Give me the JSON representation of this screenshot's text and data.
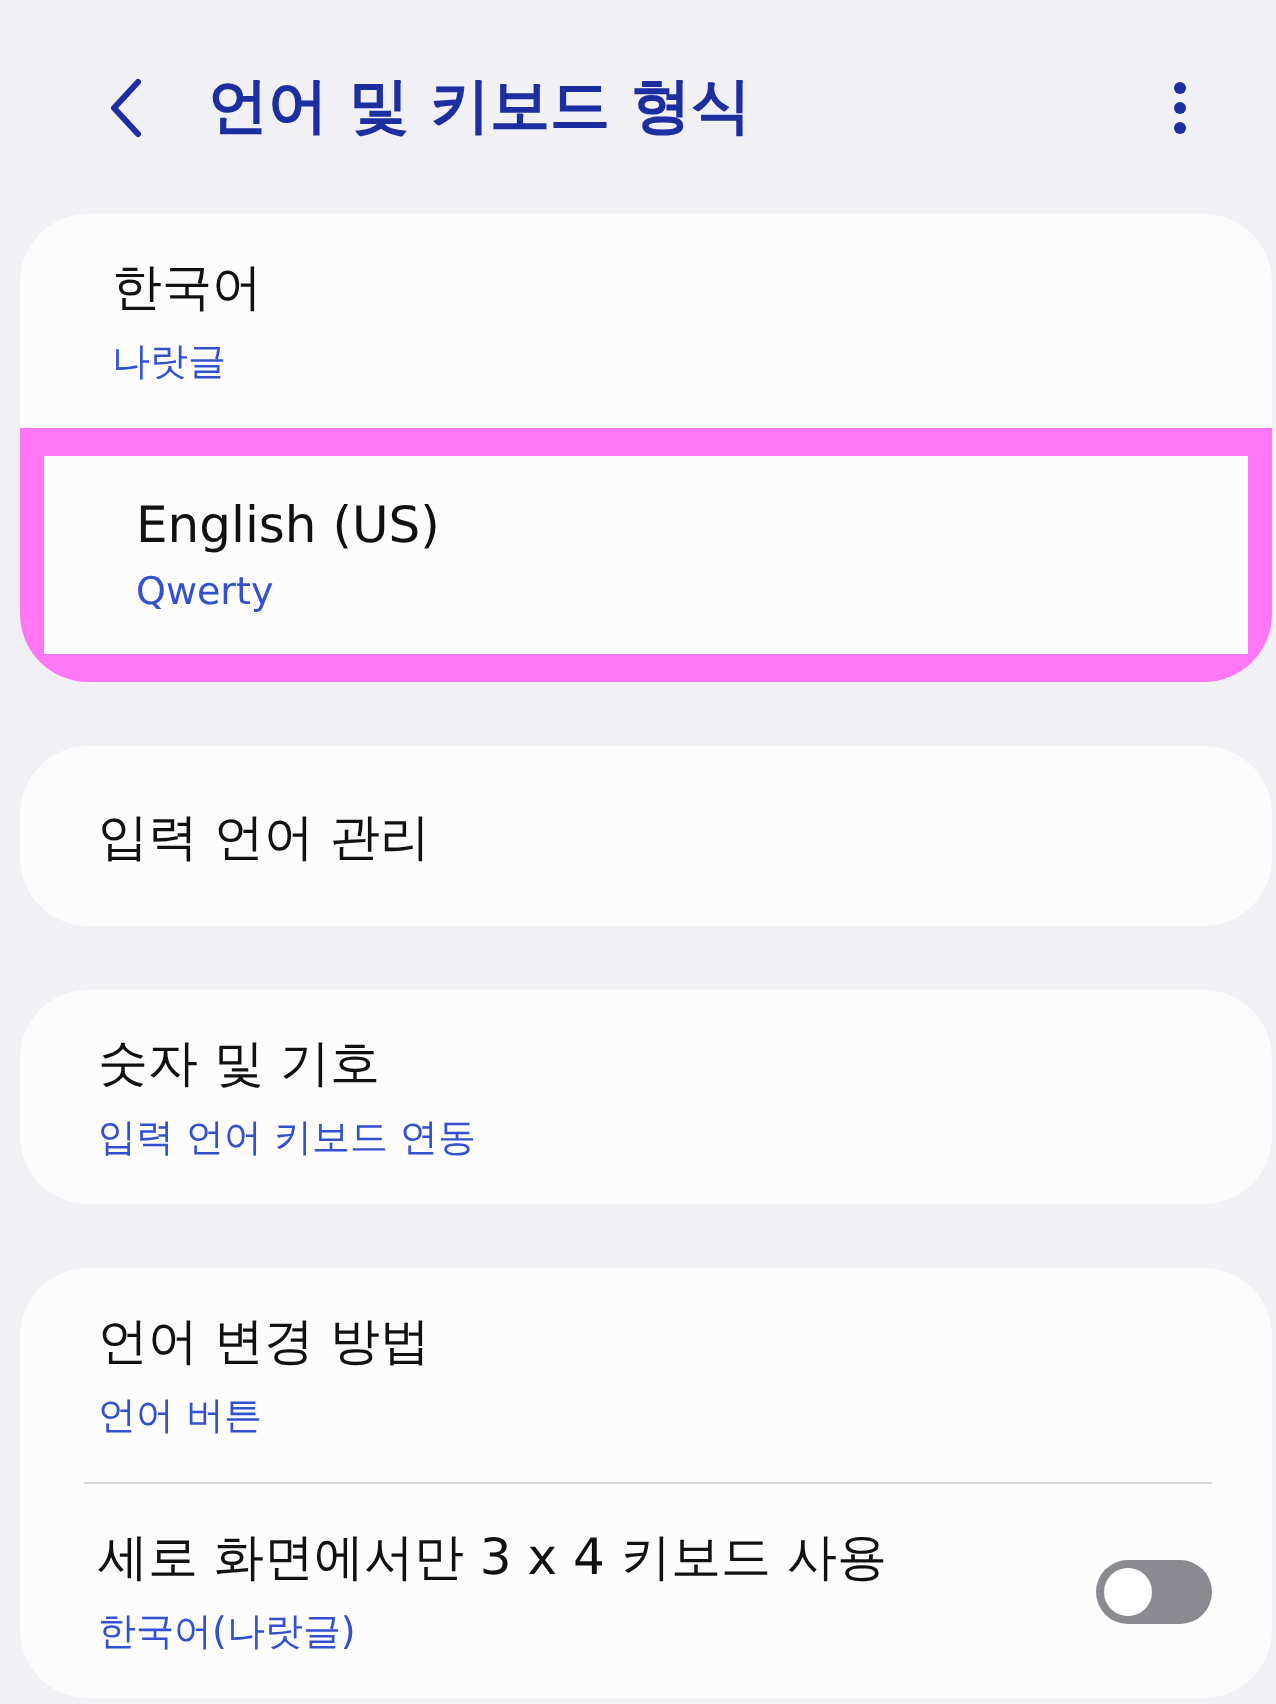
{
  "header": {
    "title": "언어 및 키보드 형식"
  },
  "groups": [
    {
      "items": [
        {
          "title": "한국어",
          "subtitle": "나랏글",
          "kind": "link",
          "highlighted": false
        },
        {
          "title": "English (US)",
          "subtitle": "Qwerty",
          "kind": "link",
          "highlighted": true
        }
      ]
    },
    {
      "items": [
        {
          "title": "입력 언어 관리",
          "kind": "link",
          "highlighted": false
        }
      ]
    },
    {
      "items": [
        {
          "title": "숫자 및 기호",
          "subtitle": "입력 언어 키보드 연동",
          "kind": "link",
          "highlighted": false
        }
      ]
    },
    {
      "items": [
        {
          "title": "언어 변경 방법",
          "subtitle": "언어 버튼",
          "kind": "link",
          "highlighted": false
        },
        {
          "title": "세로 화면에서만 3 x 4 키보드 사용",
          "subtitle": "한국어(나랏글)",
          "kind": "switch",
          "on": false,
          "highlighted": false
        }
      ]
    }
  ]
}
